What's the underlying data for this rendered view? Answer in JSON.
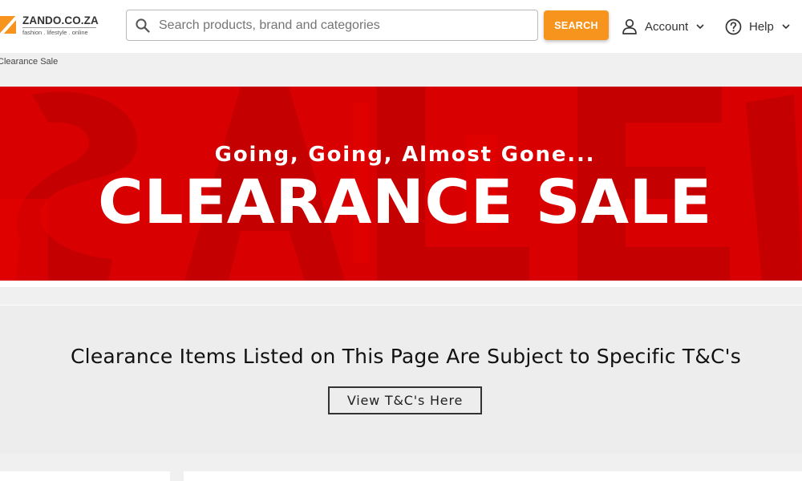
{
  "header": {
    "logo": {
      "name": "ZANDO.CO.ZA",
      "tagline": "fashion . lifestyle . online"
    },
    "search": {
      "placeholder": "Search products, brand and categories",
      "button_label": "SEARCH"
    },
    "account_label": "Account",
    "help_label": "Help"
  },
  "breadcrumb": "Clearance Sale",
  "banner": {
    "subtitle": "Going, Going, Almost Gone...",
    "title": "CLEARANCE SALE",
    "background_color": "#d80000"
  },
  "notice": {
    "text": "Clearance Items Listed on This Page Are Subject to Specific T&C's",
    "button_label": "View T&C's Here"
  },
  "colors": {
    "accent": "#f7941d",
    "banner_red": "#d80000"
  }
}
